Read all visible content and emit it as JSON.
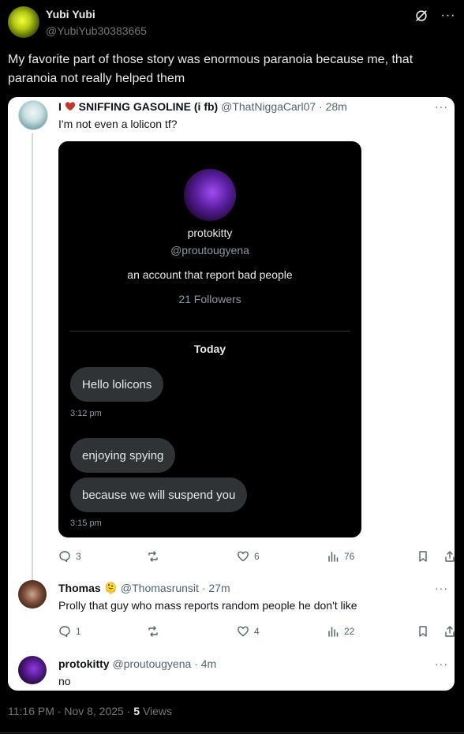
{
  "post": {
    "author_name": "Yubi Yubi",
    "author_handle": "@YubiYub30383665",
    "text": "My favorite part of those story was enormous paranoia because me, that paranoia not really helped them",
    "more_label": "···",
    "meta_time": "11:16 PM · Nov 8, 2025 · ",
    "views_count": "5",
    "views_label": "Views"
  },
  "quote": {
    "author_name_prefix": "I",
    "heart_icon": "heart-icon",
    "author_name": "SNIFFING GASOLINE (i fb)",
    "author_handle": "@ThatNiggaCarl07",
    "time": "· 28m",
    "text": "I'm not even a lolicon tf?",
    "more_label": "···",
    "screenshot": {
      "profile_name": "protokitty",
      "profile_handle": "@proutougyena",
      "bio": "an account that report bad people",
      "followers": "21 Followers",
      "date_divider": "Today",
      "messages": [
        {
          "text": "Hello lolicons",
          "time": "3:12 pm"
        },
        {
          "text": "enjoying spying"
        },
        {
          "text": "because we will suspend you",
          "time": "3:15 pm"
        }
      ]
    },
    "stats": {
      "replies": "3",
      "views": "76",
      "likes": "6"
    }
  },
  "replies": [
    {
      "author_name": "Thomas",
      "emoji": "🫠",
      "author_handle": "@Thomasrunsit",
      "time": "· 27m",
      "text": "Prolly that guy who mass reports random people he don't like",
      "stats": {
        "replies": "1",
        "likes": "4",
        "views": "22"
      }
    },
    {
      "author_name": "protokitty",
      "author_handle": "@proutougyena",
      "time": "· 4m",
      "text": "no"
    }
  ],
  "colors": {
    "background": "#000000",
    "card": "#ffffff",
    "heart": "#c0392b",
    "secondary_text": "#536471"
  }
}
